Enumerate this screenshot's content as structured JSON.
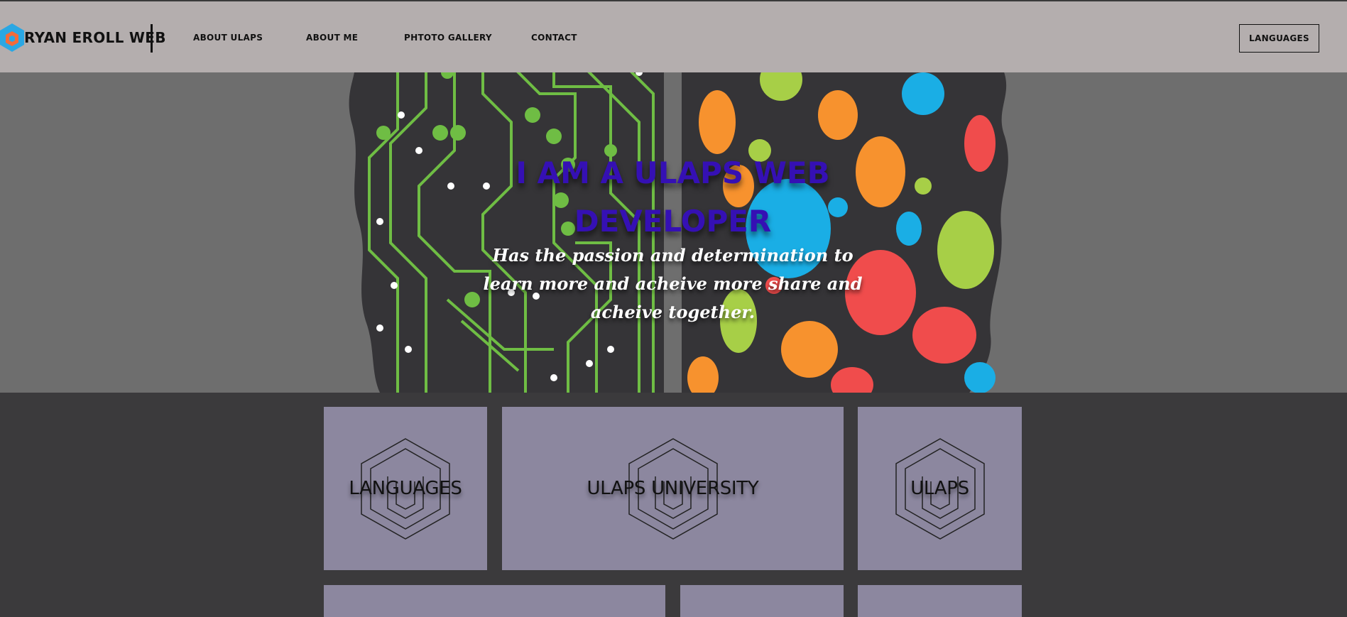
{
  "header": {
    "brand": "RYAN EROLL WEB",
    "nav": [
      {
        "label": "ABOUT ULAPS"
      },
      {
        "label": "ABOUT ME"
      },
      {
        "label": "PHTOTO GALLERY"
      },
      {
        "label": "CONTACT"
      }
    ],
    "languages_button": "LANGUAGES"
  },
  "hero": {
    "title": "I AM A ULAPS WEB DEVELOPER",
    "subtitle": "Has the passion and determination to learn more and acheive more share and acheive together."
  },
  "cards": [
    {
      "label": "LANGUAGES"
    },
    {
      "label": "ULAPS UNIVERSITY"
    },
    {
      "label": "ULAPS"
    },
    {
      "label": ""
    },
    {
      "label": ""
    },
    {
      "label": ""
    }
  ],
  "icons": {
    "logo": "hexagon-logo-icon",
    "card": "hexagon-outline-icon"
  },
  "colors": {
    "header_bg": "#b4aeae",
    "hero_bg": "#6e6e6e",
    "hero_title": "#3510b4",
    "page_bg": "#3b3a3c",
    "card_bg": "#8c879f",
    "logo_blue": "#2aa7e3",
    "logo_orange": "#f26b3a"
  }
}
